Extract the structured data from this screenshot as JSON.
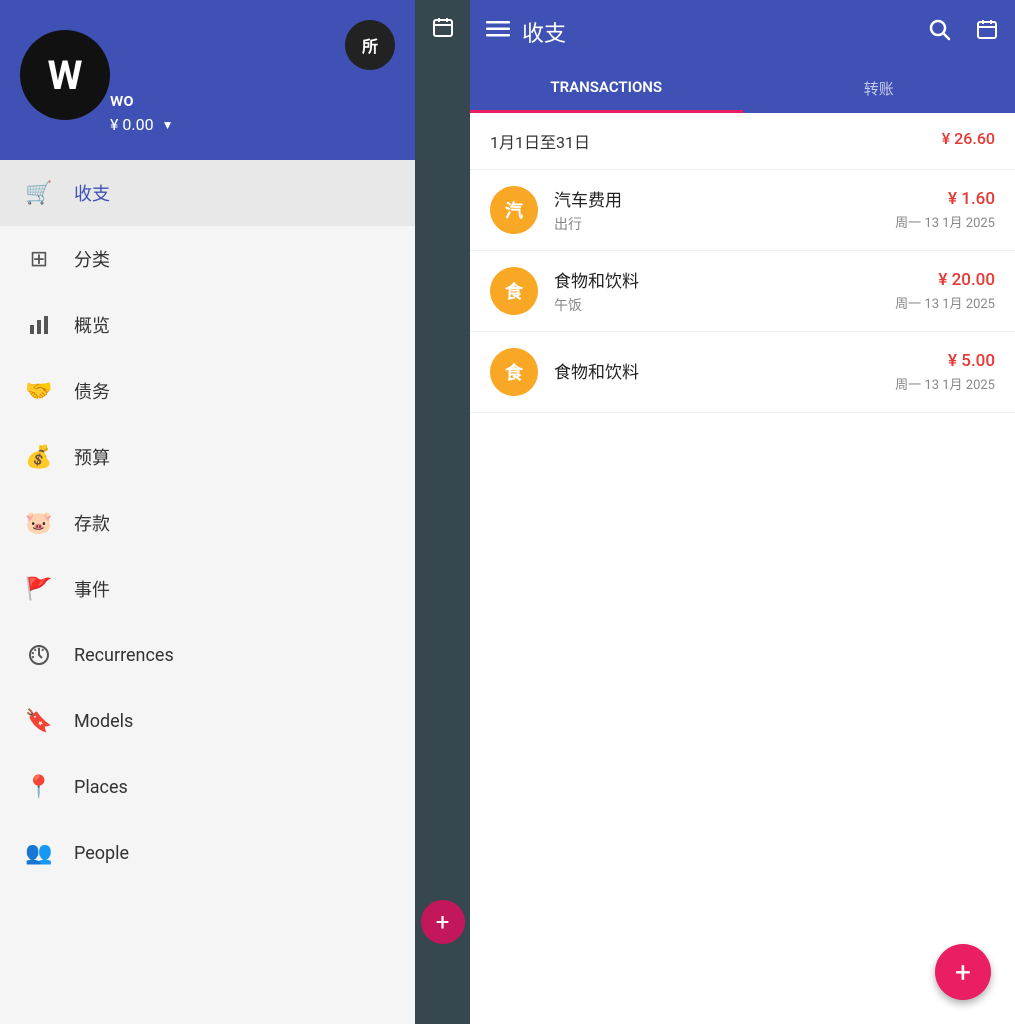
{
  "profile": {
    "avatar_letter": "W",
    "all_label": "所",
    "name": "wo",
    "balance": "¥ 0.00"
  },
  "nav": {
    "items": [
      {
        "id": "transactions",
        "label": "收支",
        "icon": "🛒",
        "active": true
      },
      {
        "id": "categories",
        "label": "分类",
        "icon": "⊞",
        "active": false
      },
      {
        "id": "overview",
        "label": "概览",
        "icon": "📊",
        "active": false
      },
      {
        "id": "debts",
        "label": "债务",
        "icon": "🤝",
        "active": false
      },
      {
        "id": "budget",
        "label": "预算",
        "icon": "💰",
        "active": false
      },
      {
        "id": "savings",
        "label": "存款",
        "icon": "🐷",
        "active": false
      },
      {
        "id": "events",
        "label": "事件",
        "icon": "🚩",
        "active": false
      },
      {
        "id": "recurrences",
        "label": "Recurrences",
        "icon": "🕐",
        "active": false
      },
      {
        "id": "models",
        "label": "Models",
        "icon": "🔖",
        "active": false
      },
      {
        "id": "places",
        "label": "Places",
        "icon": "📍",
        "active": false
      },
      {
        "id": "people",
        "label": "People",
        "icon": "👥",
        "active": false
      }
    ]
  },
  "header": {
    "title": "收支",
    "search_icon": "🔍",
    "calendar_icon": "📅",
    "menu_icon": "≡"
  },
  "tabs": [
    {
      "id": "transactions",
      "label": "TRANSACTIONS",
      "active": true
    },
    {
      "id": "transfer",
      "label": "转账",
      "active": false
    }
  ],
  "date_range": {
    "label": "1月1日至31日",
    "total": "¥ 26.60"
  },
  "transactions": [
    {
      "avatar_char": "汽",
      "title": "汽车费用",
      "subtitle": "出行",
      "amount": "¥ 1.60",
      "date": "周一 13 1月 2025"
    },
    {
      "avatar_char": "食",
      "title": "食物和饮料",
      "subtitle": "午饭",
      "amount": "¥ 20.00",
      "date": "周一 13 1月 2025"
    },
    {
      "avatar_char": "食",
      "title": "食物和饮料",
      "subtitle": "",
      "amount": "¥ 5.00",
      "date": "周一 13 1月 2025"
    }
  ],
  "fab": {
    "label": "+"
  }
}
